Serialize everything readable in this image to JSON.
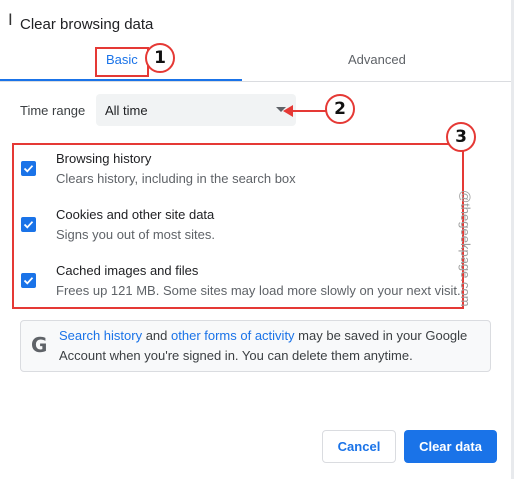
{
  "dialog": {
    "title": "Clear browsing data"
  },
  "tabs": [
    {
      "label": "Basic",
      "active": true
    },
    {
      "label": "Advanced",
      "active": false
    }
  ],
  "time_range": {
    "label": "Time range",
    "selected": "All time"
  },
  "options": [
    {
      "title": "Browsing history",
      "subtitle": "Clears history, including in the search box",
      "checked": true
    },
    {
      "title": "Cookies and other site data",
      "subtitle": "Signs you out of most sites.",
      "checked": true
    },
    {
      "title": "Cached images and files",
      "subtitle": "Frees up 121 MB. Some sites may load more slowly on your next visit.",
      "checked": true
    }
  ],
  "info": {
    "link1": "Search history",
    "text1": " and ",
    "link2": "other forms of activity",
    "text2": " may be saved in your Google",
    "line2": "Account when you're signed in. You can delete them anytime."
  },
  "buttons": {
    "cancel": "Cancel",
    "clear": "Clear data"
  },
  "annotations": {
    "b1": "1",
    "b2": "2",
    "b3": "3"
  },
  "watermark": "@thegeekpage.com",
  "colors": {
    "accent": "#1a73e8",
    "annotation": "#e53935"
  }
}
